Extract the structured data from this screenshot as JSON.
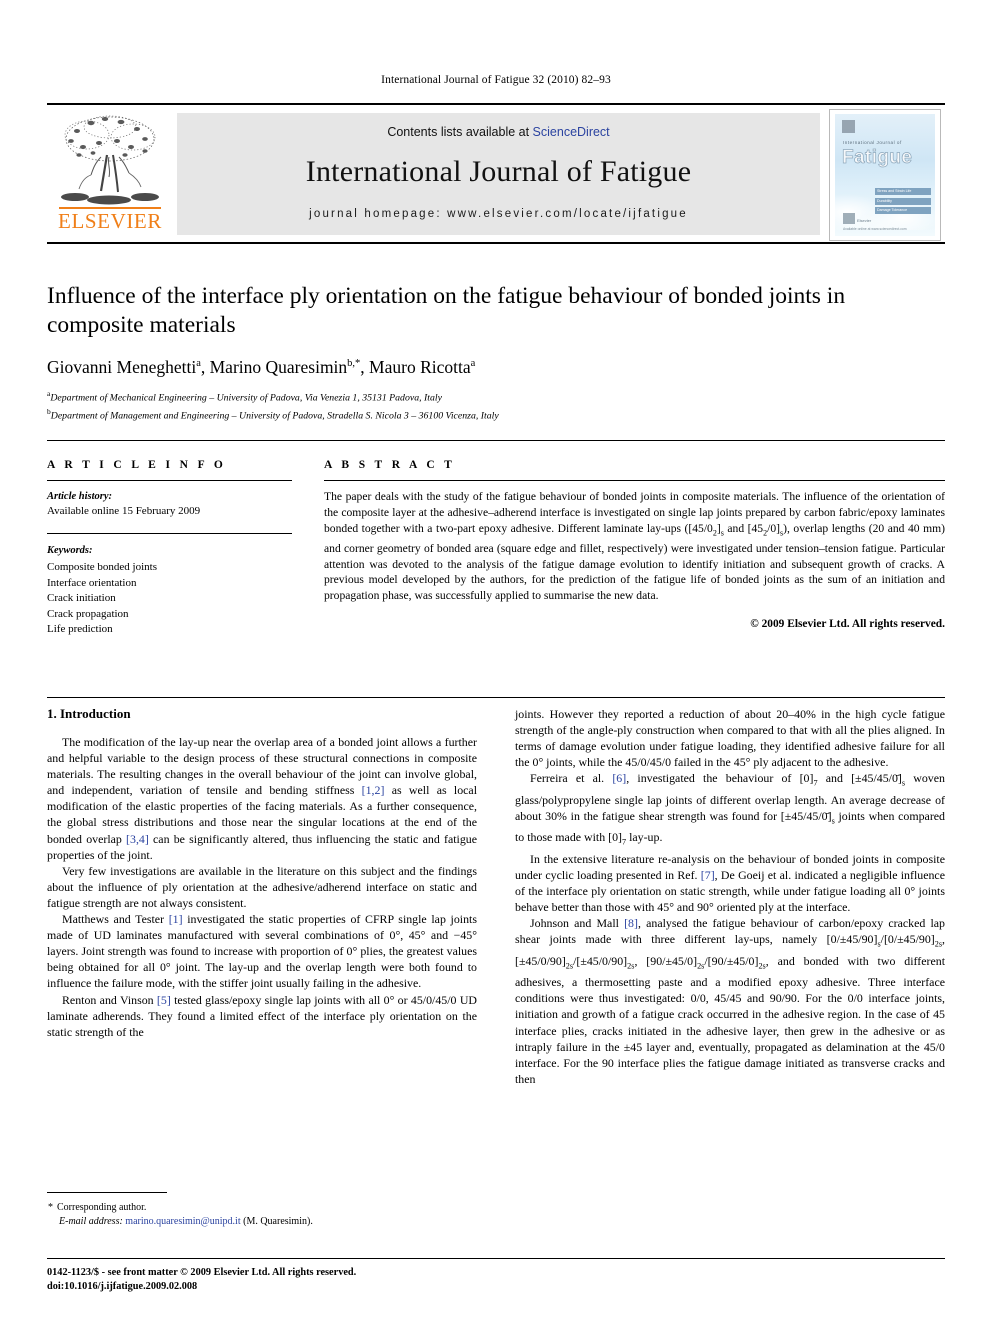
{
  "running_head": "International Journal of Fatigue 32 (2010) 82–93",
  "masthead": {
    "publisher_name": "ELSEVIER",
    "publisher_logo_icon": "elsevier-tree-icon",
    "contents_prefix": "Contents lists available at ",
    "sciencedirect_link": "ScienceDirect",
    "journal_title": "International Journal of Fatigue",
    "homepage_line": "journal homepage: www.elsevier.com/locate/ijfatigue",
    "sciencedirect_color": "#2b43a0",
    "elsevier_orange": "#F07F18",
    "band_color": "#e6e6e6",
    "cover": {
      "supertitle": "International Journal of",
      "title": "Fatigue",
      "bars": [
        "Stress and Strain Life",
        "Durability",
        "Damage Tolerance"
      ],
      "footer_mark": "Elsevier",
      "footer_line": "Available online at www.sciencedirect.com"
    }
  },
  "article": {
    "title": "Influence of the interface ply orientation on the fatigue behaviour of bonded joints in composite materials",
    "authors": [
      {
        "name": "Giovanni Meneghetti",
        "marks": "a"
      },
      {
        "name": "Marino Quaresimin",
        "marks": "b,*"
      },
      {
        "name": "Mauro Ricotta",
        "marks": "a"
      }
    ],
    "affiliations": [
      {
        "mark": "a",
        "text": "Department of Mechanical Engineering – University of Padova, Via Venezia 1, 35131 Padova, Italy"
      },
      {
        "mark": "b",
        "text": "Department of Management and Engineering – University of Padova, Stradella S. Nicola 3 – 36100 Vicenza, Italy"
      }
    ]
  },
  "info": {
    "heading": "A R T I C L E  I N F O",
    "history_label": "Article history:",
    "history_value": "Available online 15 February 2009",
    "keywords_label": "Keywords:",
    "keywords": [
      "Composite bonded joints",
      "Interface orientation",
      "Crack initiation",
      "Crack propagation",
      "Life prediction"
    ]
  },
  "abstract": {
    "heading": "A B S T R A C T",
    "p1_a": "The paper deals with the study of the fatigue behaviour of bonded joints in composite materials. The influence of the orientation of the composite layer at the adhesive–adherend interface is investigated on single lap joints prepared by carbon fabric/epoxy laminates bonded together with a two-part epoxy adhesive. Different laminate lay-ups ([45/0",
    "sub1": "2",
    "p1_b": "]",
    "sub2": "s",
    "p1_c": " and [45",
    "sub3": "2",
    "p1_d": "/0]",
    "sub4": "s",
    "p1_e": "), overlap lengths (20 and 40 mm) and corner geometry of bonded area (square edge and fillet, respectively) were investigated under tension–tension fatigue. Particular attention was devoted to the analysis of the fatigue damage evolution to identify initiation and subsequent growth of cracks. A previous model developed by the authors, for the prediction of the fatigue life of bonded joints as the sum of an initiation and propagation phase, was successfully applied to summarise the new data.",
    "copyright": "© 2009 Elsevier Ltd. All rights reserved."
  },
  "body": {
    "section_title": "1. Introduction",
    "left": {
      "p1_a": "The modification of the lay-up near the overlap area of a bonded joint allows a further and helpful variable to the design process of these structural connections in composite materials. The resulting changes in the overall behaviour of the joint can involve global, and independent, variation of tensile and bending stiffness ",
      "p1_ref1": "[1,2]",
      "p1_b": " as well as local modification of the elastic properties of the facing materials. As a further consequence, the global stress distributions and those near the singular locations at the end of the bonded overlap ",
      "p1_ref2": "[3,4]",
      "p1_c": " can be significantly altered, thus influencing the static and fatigue properties of the joint.",
      "p2": "Very few investigations are available in the literature on this subject and the findings about the influence of ply orientation at the adhesive/adherend interface on static and fatigue strength are not always consistent.",
      "p3_a": "Matthews and Tester ",
      "p3_ref": "[1]",
      "p3_b": " investigated the static properties of CFRP single lap joints made of UD laminates manufactured with several combinations of 0°, 45° and −45° layers. Joint strength was found to increase with proportion of 0° plies, the greatest values being obtained for all 0° joint. The lay-up and the overlap length were both found to influence the failure mode, with the stiffer joint usually failing in the adhesive.",
      "p4_a": "Renton and Vinson ",
      "p4_ref": "[5]",
      "p4_b": " tested glass/epoxy single lap joints with all 0° or 45/0/45/0 UD laminate adherends. They found a limited effect of the interface ply orientation on the static strength of the"
    },
    "right": {
      "p1": "joints. However they reported a reduction of about 20–40% in the high cycle fatigue strength of the angle-ply construction when compared to that with all the plies aligned. In terms of damage evolution under fatigue loading, they identified adhesive failure for all the 0° joints, while the 45/0/45/0 failed in the 45° ply adjacent to the adhesive.",
      "p2_a": "Ferreira et al. ",
      "p2_ref": "[6]",
      "p2_b": ", investigated the behaviour of [0]",
      "p2_sub1": "7",
      "p2_c": " and [±45/45/0̄]",
      "p2_sub2": "s",
      "p2_d": " woven glass/polypropylene single lap joints of different overlap length. An average decrease of about 30% in the fatigue shear strength was found for [±45/45/0̄]",
      "p2_sub3": "s",
      "p2_e": " joints when compared to those made with [0]",
      "p2_sub4": "7",
      "p2_f": " lay-up.",
      "p3_a": "In the extensive literature re-analysis on the behaviour of bonded joints in composite under cyclic loading presented in Ref. ",
      "p3_ref": "[7]",
      "p3_b": ", De Goeij et al. indicated a negligible influence of the interface ply orientation on static strength, while under fatigue loading all 0° joints behave better than those with 45° and 90° oriented ply at the interface.",
      "p4_a": "Johnson and Mall ",
      "p4_ref": "[8]",
      "p4_b": ", analysed the fatigue behaviour of carbon/epoxy cracked lap shear joints made with three different lay-ups, namely [0/±45/90]",
      "p4_sub1": "s",
      "p4_c": "/[0/±45/90]",
      "p4_sub2": "2s",
      "p4_d": ", [±45/0/90]",
      "p4_sub3": "2s",
      "p4_e": "/[±45/0/90]",
      "p4_sub4": "2s",
      "p4_f": ", [90/±45/0]",
      "p4_sub5": "2s",
      "p4_g": "/[90/±45/0]",
      "p4_sub6": "2s",
      "p4_h": ", and bonded with two different adhesives, a thermosetting paste and a modified epoxy adhesive. Three interface conditions were thus investigated: 0/0, 45/45 and 90/90. For the 0/0 interface joints, initiation and growth of a fatigue crack occurred in the adhesive region. In the case of 45 interface plies, cracks initiated in the adhesive layer, then grew in the adhesive or as intraply failure in the ±45 layer and, eventually, propagated as delamination at the 45/0 interface. For the 90 interface plies the fatigue damage initiated as transverse cracks and then"
    }
  },
  "footnote": {
    "star": "*",
    "corresponding": "Corresponding author.",
    "email_label": "E-mail address:",
    "email": "marino.quaresimin@unipd.it",
    "email_owner": "(M. Quaresimin).",
    "link_color": "#2b43a0"
  },
  "footer": {
    "line1": "0142-1123/$ - see front matter © 2009 Elsevier Ltd. All rights reserved.",
    "line2": "doi:10.1016/j.ijfatigue.2009.02.008"
  }
}
